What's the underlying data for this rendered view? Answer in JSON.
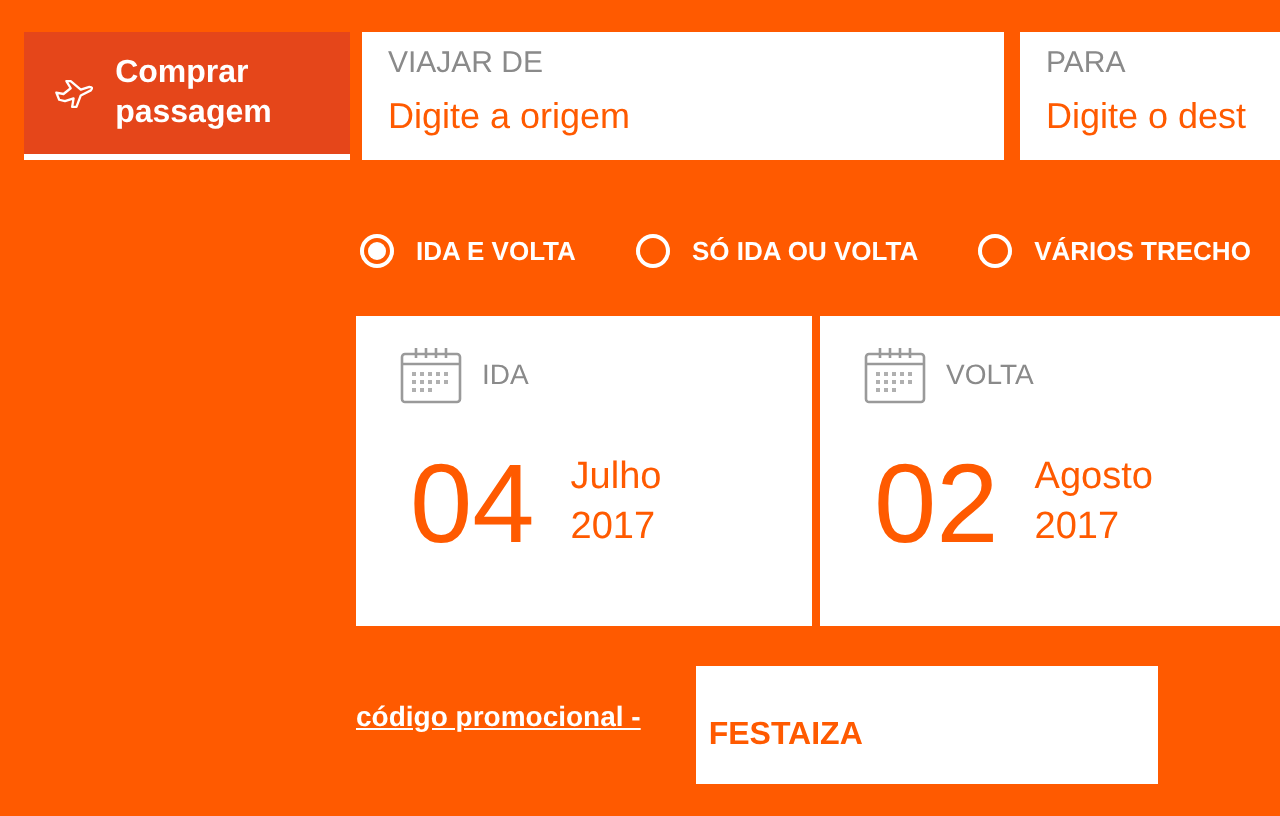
{
  "buy_tab": {
    "label": "Comprar passagem",
    "selected": true
  },
  "fields": [
    {
      "label": "VIAJAR DE",
      "placeholder": "Digite a origem"
    },
    {
      "label": "PARA",
      "placeholder": "Digite o dest"
    }
  ],
  "trip_types": [
    {
      "label": "IDA E VOLTA",
      "selected": true
    },
    {
      "label": "SÓ IDA OU VOLTA",
      "selected": false
    },
    {
      "label": "VÁRIOS TRECHO",
      "selected": false
    }
  ],
  "dates": [
    {
      "label": "IDA",
      "day": "04",
      "month": "Julho",
      "year": "2017"
    },
    {
      "label": "VOLTA",
      "day": "02",
      "month": "Agosto",
      "year": "2017"
    }
  ],
  "promo": {
    "link": "código promocional -",
    "value": "FESTAIZA"
  }
}
